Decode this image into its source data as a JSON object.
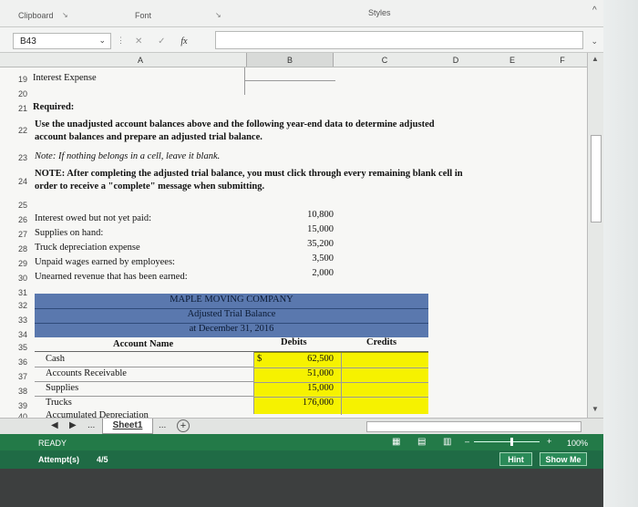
{
  "ribbon": {
    "clipboard": "Clipboard",
    "font": "Font",
    "styles": "Styles",
    "launcher_icon": "dialog-launcher-icon"
  },
  "formula_bar": {
    "name_box": "B43",
    "cancel": "✕",
    "enter": "✓",
    "fx": "fx",
    "value": ""
  },
  "columns": [
    "A",
    "B",
    "C",
    "D",
    "E",
    "F"
  ],
  "rows": {
    "r19": {
      "num": "19",
      "a": "Interest Expense"
    },
    "r20": {
      "num": "20"
    },
    "r21": {
      "num": "21",
      "a": "Required:"
    },
    "r22": {
      "num": "22",
      "a1": "Use the unadjusted account balances above and the following year-end data to determine adjusted",
      "a2": "account balances and prepare an adjusted trial balance."
    },
    "r23": {
      "num": "23",
      "a": "Note: If nothing belongs in a cell, leave it blank."
    },
    "r24": {
      "num": "24",
      "a1": "NOTE: After completing the adjusted trial balance, you must click through every remaining blank cell in",
      "a2": "order to receive a \"complete\" message when submitting."
    },
    "r25": {
      "num": "25"
    },
    "r26": {
      "num": "26",
      "a": "Interest owed but not yet paid:",
      "b": "10,800"
    },
    "r27": {
      "num": "27",
      "a": "Supplies on hand:",
      "b": "15,000"
    },
    "r28": {
      "num": "28",
      "a": "Truck depreciation expense",
      "b": "35,200"
    },
    "r29": {
      "num": "29",
      "a": "Unpaid wages earned by employees:",
      "b": "3,500"
    },
    "r30": {
      "num": "30",
      "a": "Unearned revenue that has been earned:",
      "b": "2,000"
    },
    "r31": {
      "num": "31"
    },
    "r32": {
      "num": "32",
      "title": "MAPLE MOVING COMPANY"
    },
    "r33": {
      "num": "33",
      "title": "Adjusted Trial Balance"
    },
    "r34": {
      "num": "34",
      "title": "at December 31, 2016"
    },
    "r35": {
      "num": "35",
      "account": "Account Name",
      "debits": "Debits",
      "credits": "Credits"
    },
    "r36": {
      "num": "36",
      "account": "Cash",
      "currency": "$",
      "debit": "62,500"
    },
    "r37": {
      "num": "37",
      "account": "Accounts Receivable",
      "debit": "51,000"
    },
    "r38": {
      "num": "38",
      "account": "Supplies",
      "debit": "15,000"
    },
    "r39": {
      "num": "39",
      "account": "Trucks",
      "debit": "176,000"
    },
    "r40": {
      "num": "40",
      "account": "Accumulated Depreciation"
    }
  },
  "sheet_bar": {
    "prev": "◀",
    "next": "▶",
    "more": "...",
    "tab": "Sheet1",
    "add": "+"
  },
  "status_bar": {
    "ready": "READY",
    "zoom": "100%"
  },
  "attempt_bar": {
    "label": "Attempt(s)",
    "value": "4/5",
    "hint": "Hint",
    "show_me": "Show Me"
  },
  "colors": {
    "band": "#5a78ae",
    "yellow": "#f6f200",
    "status": "#237a48"
  }
}
